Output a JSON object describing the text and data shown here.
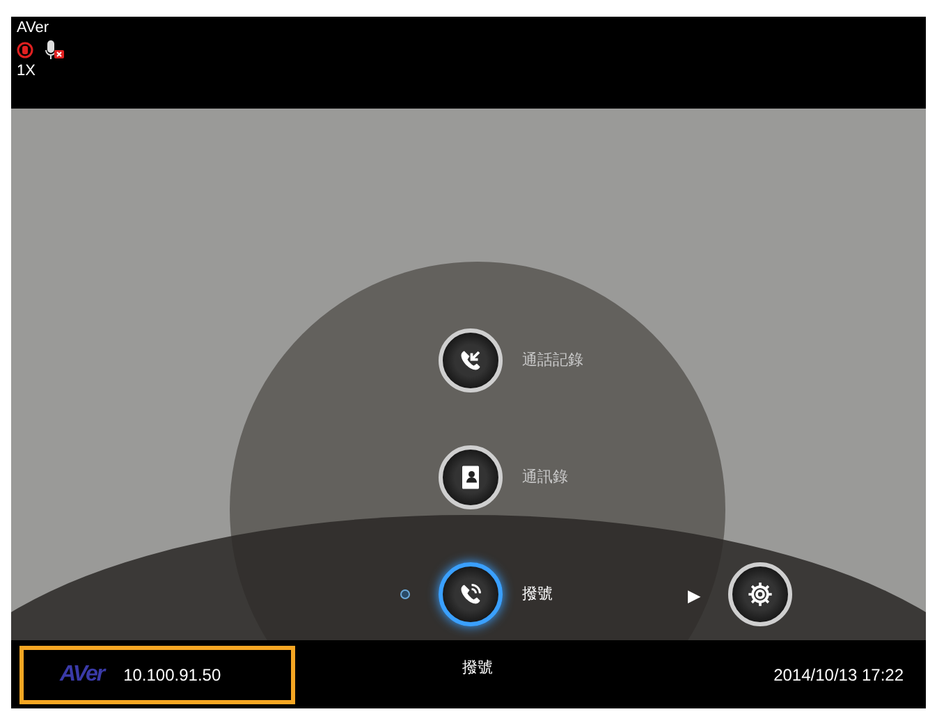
{
  "top_bar": {
    "brand": "AVer",
    "zoom": "1X",
    "recording": true,
    "mic_muted": true
  },
  "menu": {
    "items": [
      {
        "kind": "call-log",
        "label": "通話記錄",
        "selected": false
      },
      {
        "kind": "phonebook",
        "label": "通訊錄",
        "selected": false
      },
      {
        "kind": "dial",
        "label": "撥號",
        "selected": true
      }
    ],
    "next_arrow": "▶"
  },
  "status_bar": {
    "logo": "AVer",
    "ip": "10.100.91.50",
    "mode": "撥號",
    "datetime": "2014/10/13 17:22",
    "highlighted": true
  }
}
